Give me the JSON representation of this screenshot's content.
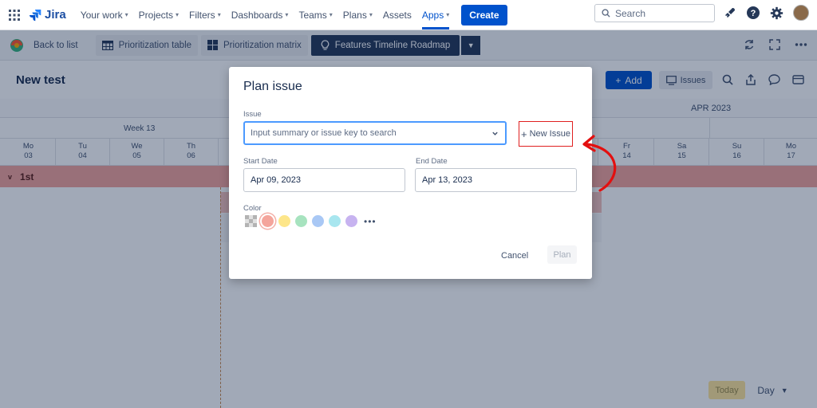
{
  "topnav": {
    "logo": "Jira",
    "items": [
      "Your work",
      "Projects",
      "Filters",
      "Dashboards",
      "Teams",
      "Plans",
      "Assets",
      "Apps"
    ],
    "create": "Create",
    "search_placeholder": "Search"
  },
  "toolbar": {
    "back": "Back to list",
    "tabs": [
      "Prioritization table",
      "Prioritization matrix",
      "Features Timeline Roadmap"
    ]
  },
  "board": {
    "title": "New test",
    "add": "Add",
    "issues": "Issues"
  },
  "timeline": {
    "month": "APR 2023",
    "week": "Week 13",
    "days": [
      {
        "dow": "Mo",
        "num": "03"
      },
      {
        "dow": "Tu",
        "num": "04"
      },
      {
        "dow": "We",
        "num": "05"
      },
      {
        "dow": "Th",
        "num": "06"
      },
      {
        "dow": "",
        "num": ""
      },
      {
        "dow": "",
        "num": ""
      },
      {
        "dow": "",
        "num": ""
      },
      {
        "dow": "",
        "num": ""
      },
      {
        "dow": "",
        "num": ""
      },
      {
        "dow": "",
        "num": ""
      },
      {
        "dow": "",
        "num": ""
      },
      {
        "dow": "Fr",
        "num": "14"
      },
      {
        "dow": "Sa",
        "num": "15"
      },
      {
        "dow": "Su",
        "num": "16"
      },
      {
        "dow": "Mo",
        "num": "17"
      }
    ],
    "group": "1st",
    "today": "Today",
    "scale": "Day"
  },
  "modal": {
    "title": "Plan issue",
    "issue_label": "Issue",
    "issue_placeholder": "Input summary or issue key to search",
    "new_issue": "New Issue",
    "start_label": "Start Date",
    "start_value": "Apr 09, 2023",
    "end_label": "End Date",
    "end_value": "Apr 13, 2023",
    "color_label": "Color",
    "colors": [
      "#f4a59c",
      "#fde68a",
      "#a7e3bf",
      "#a9c8f5",
      "#a8e6ef",
      "#c7b3f0"
    ],
    "more": "•••",
    "cancel": "Cancel",
    "plan": "Plan"
  }
}
